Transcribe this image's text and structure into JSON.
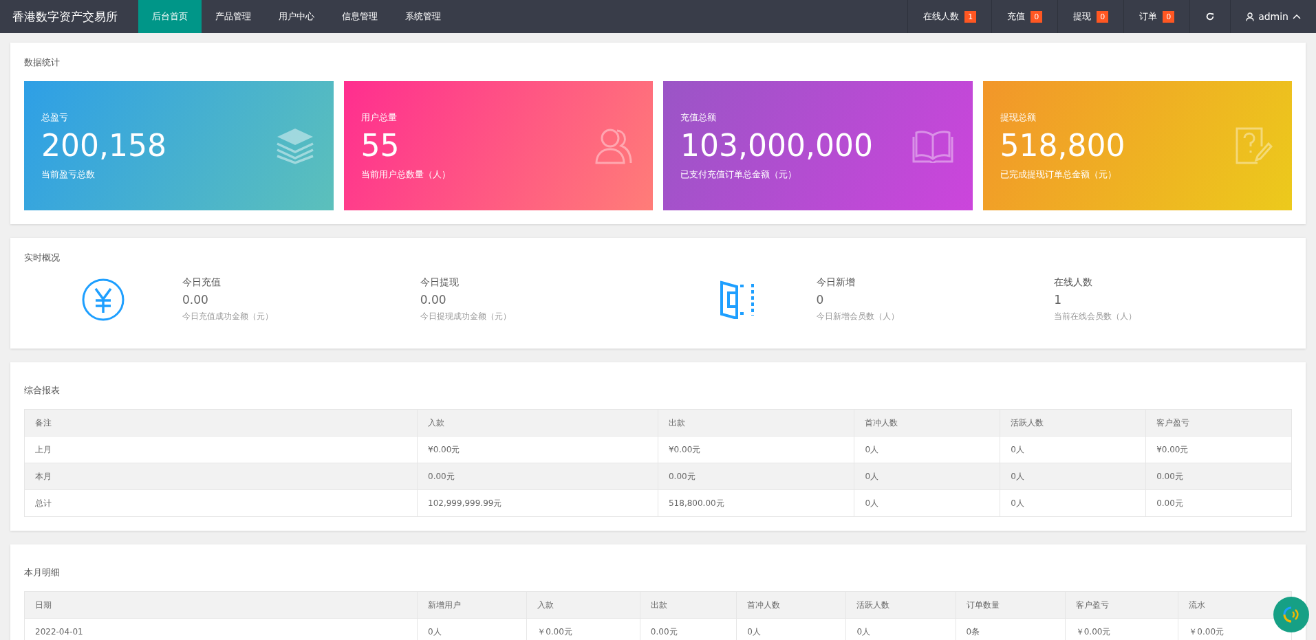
{
  "header": {
    "brand": "香港数字资产交易所",
    "nav": [
      {
        "label": "后台首页",
        "selected": true
      },
      {
        "label": "产品管理",
        "selected": false
      },
      {
        "label": "用户中心",
        "selected": false
      },
      {
        "label": "信息管理",
        "selected": false
      },
      {
        "label": "系统管理",
        "selected": false
      }
    ],
    "counters": [
      {
        "label": "在线人数",
        "badge": "1"
      },
      {
        "label": "充值",
        "badge": "0"
      },
      {
        "label": "提现",
        "badge": "0"
      },
      {
        "label": "订单",
        "badge": "0"
      }
    ],
    "user": "admin"
  },
  "stats": {
    "title": "数据统计",
    "cards": [
      {
        "kind": "layers",
        "label": "总盈亏",
        "value": "200,158",
        "note": "当前盈亏总数"
      },
      {
        "kind": "users",
        "label": "用户总量",
        "value": "55",
        "note": "当前用户总数量（人）"
      },
      {
        "kind": "book",
        "label": "充值总额",
        "value": "103,000,000",
        "note": "已支付充值订单总金额（元）"
      },
      {
        "kind": "question",
        "label": "提现总额",
        "value": "518,800",
        "note": "已完成提现订单总金额（元）"
      }
    ]
  },
  "realtime": {
    "title": "实时概况",
    "groups": [
      {
        "kind": "yen",
        "items": [
          {
            "label": "今日充值",
            "value": "0.00",
            "note": "今日充值成功金额（元）"
          },
          {
            "label": "今日提现",
            "value": "0.00",
            "note": "今日提现成功金额（元）"
          }
        ]
      },
      {
        "kind": "door",
        "items": [
          {
            "label": "今日新增",
            "value": "0",
            "note": "今日新增会员数（人）"
          },
          {
            "label": "在线人数",
            "value": "1",
            "note": "当前在线会员数（人）"
          }
        ]
      }
    ]
  },
  "report": {
    "title": "综合报表",
    "columns": [
      "备注",
      "入款",
      "出款",
      "首冲人数",
      "活跃人数",
      "客户盈亏"
    ],
    "rows": [
      [
        "上月",
        "¥0.00元",
        "¥0.00元",
        "0人",
        "0人",
        "¥0.00元"
      ],
      [
        "本月",
        "0.00元",
        "0.00元",
        "0人",
        "0人",
        "0.00元"
      ],
      [
        "总计",
        "102,999,999.99元",
        "518,800.00元",
        "0人",
        "0人",
        "0.00元"
      ]
    ]
  },
  "monthly": {
    "title": "本月明细",
    "columns": [
      "日期",
      "新增用户",
      "入款",
      "出款",
      "首冲人数",
      "活跃人数",
      "订单数量",
      "客户盈亏",
      "流水"
    ],
    "rows": [
      [
        "2022-04-01",
        "0人",
        "￥0.00元",
        "0.00元",
        "0人",
        "0人",
        "0条",
        "￥0.00元",
        "￥0.00元"
      ]
    ]
  }
}
